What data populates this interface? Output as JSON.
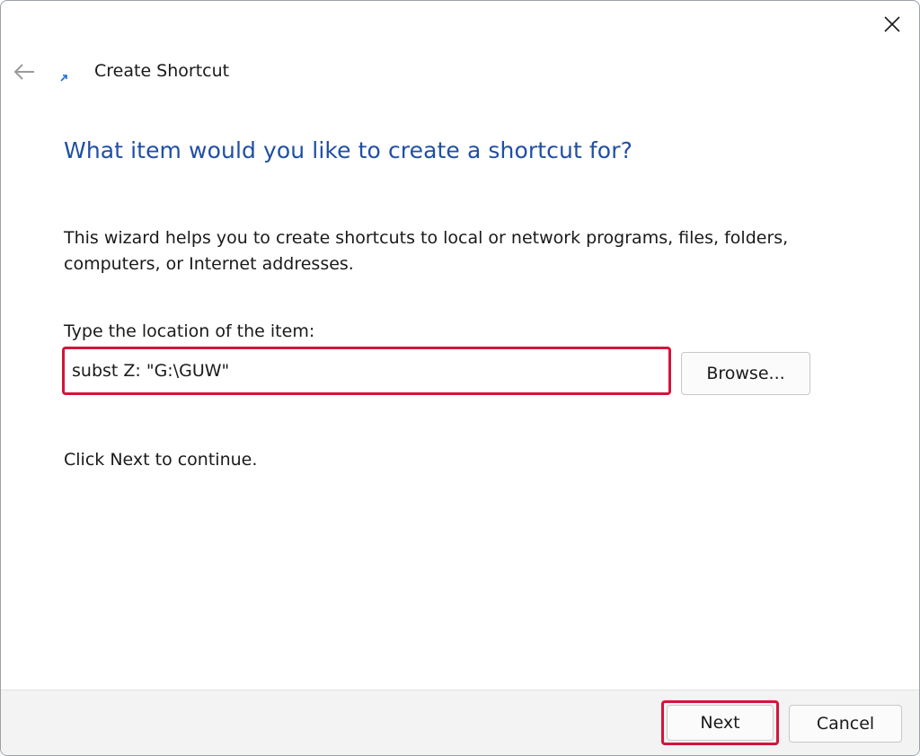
{
  "window": {
    "title": "Create Shortcut",
    "close_icon": "close-icon",
    "back_icon": "arrow-left-icon",
    "app_icon": "shortcut-arrow-icon"
  },
  "page": {
    "heading": "What item would you like to create a shortcut for?",
    "description": "This wizard helps you to create shortcuts to local or network programs, files, folders, computers, or Internet addresses.",
    "location_label": "Type the location of the item:",
    "location_value": "subst Z: \"G:\\GUW\"",
    "browse_label": "Browse...",
    "continue_text": "Click Next to continue."
  },
  "footer": {
    "next_label": "Next",
    "cancel_label": "Cancel"
  },
  "colors": {
    "heading": "#1f4fa4",
    "highlight": "#d4143c",
    "footer_bg": "#f3f3f3"
  }
}
